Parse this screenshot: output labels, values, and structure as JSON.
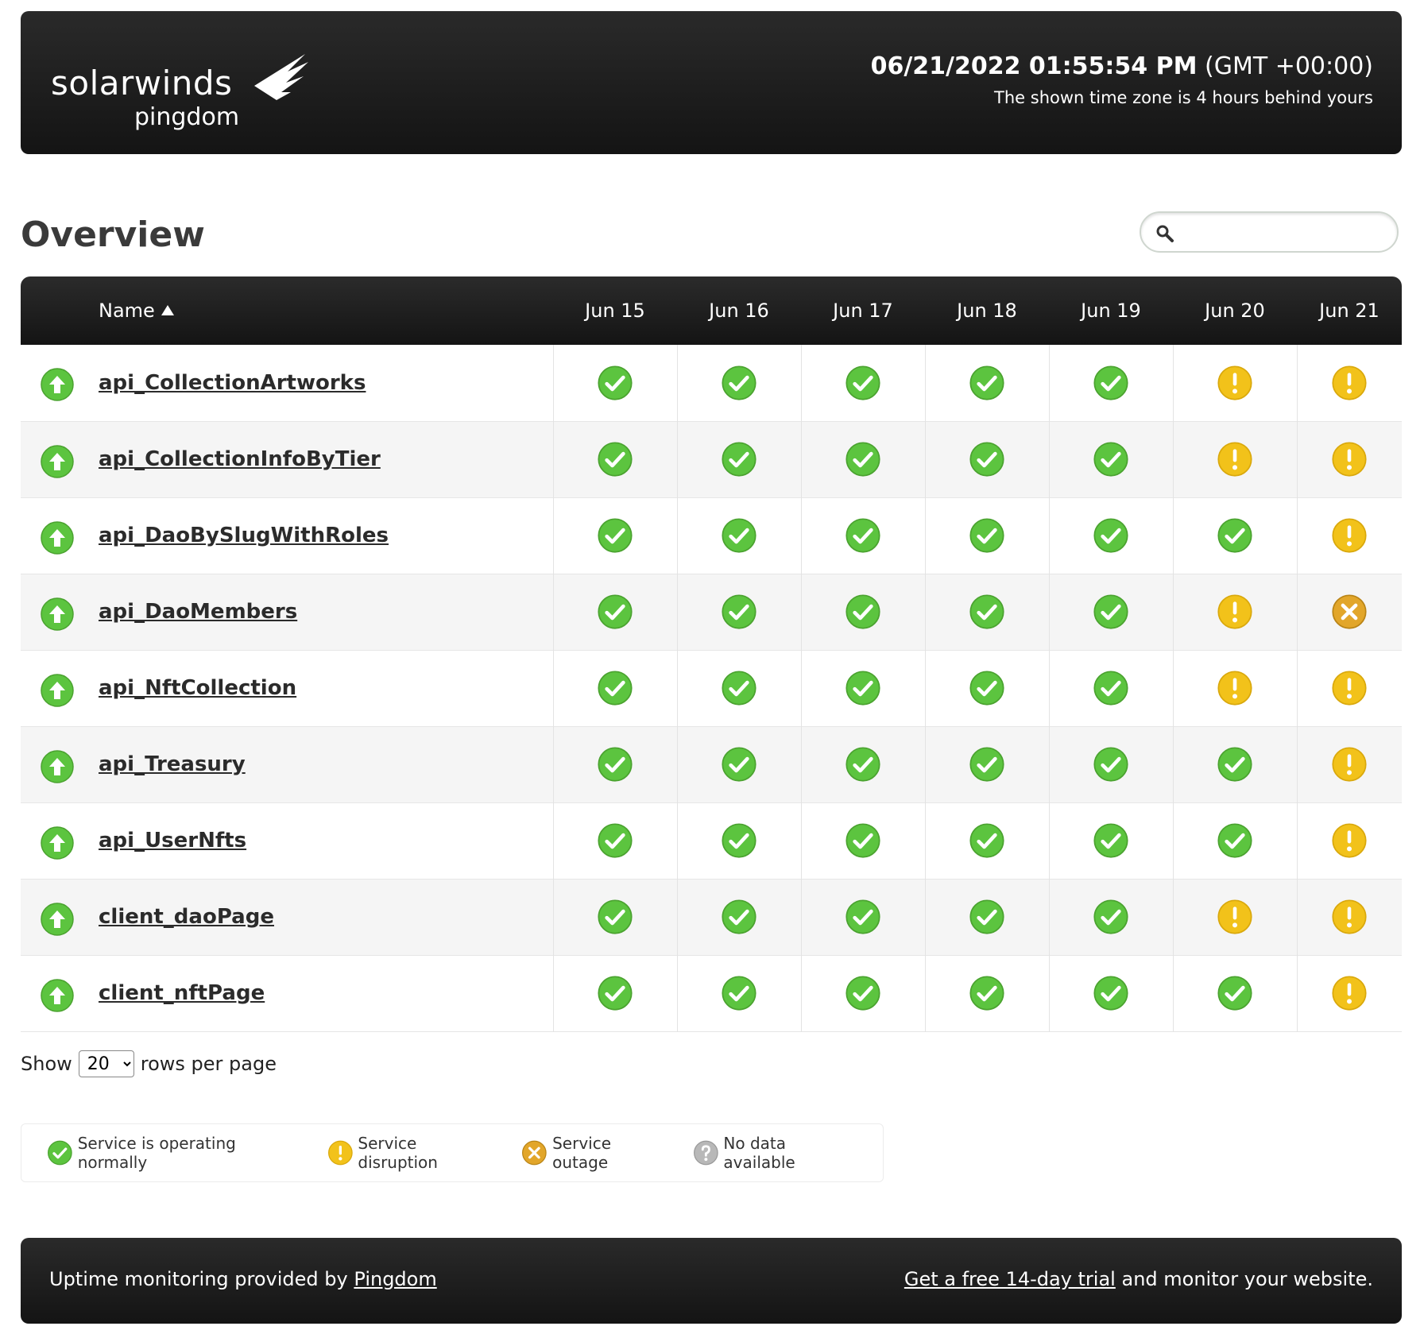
{
  "brand": {
    "logo_top": "solarwinds",
    "logo_bottom": "pingdom"
  },
  "clock": {
    "datetime": "06/21/2022 01:55:54 PM",
    "timezone": "(GMT +00:00)",
    "note": "The shown time zone is 4 hours behind yours"
  },
  "page": {
    "title": "Overview"
  },
  "search": {
    "placeholder": "",
    "value": ""
  },
  "table": {
    "name_header": "Name",
    "sort": "ascending",
    "dates": [
      "Jun 15",
      "Jun 16",
      "Jun 17",
      "Jun 18",
      "Jun 19",
      "Jun 20",
      "Jun 21"
    ],
    "rows": [
      {
        "name": "api_CollectionArtworks",
        "state": "up",
        "days": [
          "ok",
          "ok",
          "ok",
          "ok",
          "ok",
          "disruption",
          "disruption"
        ]
      },
      {
        "name": "api_CollectionInfoByTier",
        "state": "up",
        "days": [
          "ok",
          "ok",
          "ok",
          "ok",
          "ok",
          "disruption",
          "disruption"
        ]
      },
      {
        "name": "api_DaoBySlugWithRoles",
        "state": "up",
        "days": [
          "ok",
          "ok",
          "ok",
          "ok",
          "ok",
          "ok",
          "disruption"
        ]
      },
      {
        "name": "api_DaoMembers",
        "state": "up",
        "days": [
          "ok",
          "ok",
          "ok",
          "ok",
          "ok",
          "disruption",
          "outage"
        ]
      },
      {
        "name": "api_NftCollection",
        "state": "up",
        "days": [
          "ok",
          "ok",
          "ok",
          "ok",
          "ok",
          "disruption",
          "disruption"
        ]
      },
      {
        "name": "api_Treasury",
        "state": "up",
        "days": [
          "ok",
          "ok",
          "ok",
          "ok",
          "ok",
          "ok",
          "disruption"
        ]
      },
      {
        "name": "api_UserNfts",
        "state": "up",
        "days": [
          "ok",
          "ok",
          "ok",
          "ok",
          "ok",
          "ok",
          "disruption"
        ]
      },
      {
        "name": "client_daoPage",
        "state": "up",
        "days": [
          "ok",
          "ok",
          "ok",
          "ok",
          "ok",
          "disruption",
          "disruption"
        ]
      },
      {
        "name": "client_nftPage",
        "state": "up",
        "days": [
          "ok",
          "ok",
          "ok",
          "ok",
          "ok",
          "ok",
          "disruption"
        ]
      }
    ]
  },
  "pager": {
    "show_label": "Show",
    "rows_value": "20",
    "rows_options": [
      "20"
    ],
    "suffix_label": "rows per page"
  },
  "legend": {
    "ok": "Service is operating normally",
    "disruption": "Service disruption",
    "outage": "Service outage",
    "nodata": "No data available"
  },
  "footer": {
    "left_prefix": "Uptime monitoring provided by",
    "left_link": "Pingdom",
    "right_link": "Get a free 14-day trial",
    "right_suffix": "and monitor your website."
  },
  "colors": {
    "ok": "#5cc43f",
    "disruption": "#f2c21a",
    "outage": "#e2a62a",
    "nodata": "#b8b8b8",
    "header_bg": "#1c1c1c"
  },
  "icons": {
    "up": "arrow-up-icon",
    "ok": "check-circle-icon",
    "disruption": "exclamation-circle-icon",
    "outage": "x-circle-icon",
    "nodata": "question-circle-icon",
    "search": "search-icon"
  }
}
